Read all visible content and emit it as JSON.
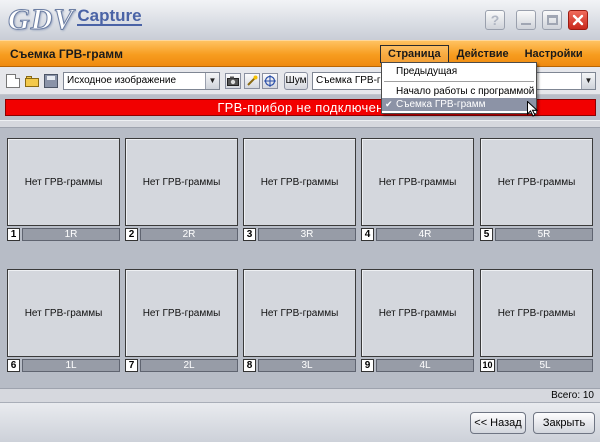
{
  "app": {
    "logo_main": "GDV",
    "logo_sub": "Capture",
    "help_label": "?"
  },
  "header": {
    "title": "Съемка ГРВ-грамм",
    "menu": [
      "Страница",
      "Действие",
      "Настройки"
    ]
  },
  "dropdown": {
    "items": [
      "Предыдущая",
      "Начало работы с программой",
      "Съемка ГРВ-грамм"
    ],
    "checked_index": 2
  },
  "toolbar": {
    "source_select_value": "Исходное изображение",
    "noise_label": "Шум",
    "mode_select_value": "Съемка ГРВ-грамм"
  },
  "status": {
    "message": "ГРВ-прибор не подключен"
  },
  "grid": {
    "cells": [
      {
        "num": "1",
        "label": "1R",
        "placeholder": "Нет ГРВ-граммы"
      },
      {
        "num": "2",
        "label": "2R",
        "placeholder": "Нет ГРВ-граммы"
      },
      {
        "num": "3",
        "label": "3R",
        "placeholder": "Нет ГРВ-граммы"
      },
      {
        "num": "4",
        "label": "4R",
        "placeholder": "Нет ГРВ-граммы"
      },
      {
        "num": "5",
        "label": "5R",
        "placeholder": "Нет ГРВ-граммы"
      },
      {
        "num": "6",
        "label": "1L",
        "placeholder": "Нет ГРВ-граммы"
      },
      {
        "num": "7",
        "label": "2L",
        "placeholder": "Нет ГРВ-граммы"
      },
      {
        "num": "8",
        "label": "3L",
        "placeholder": "Нет ГРВ-граммы"
      },
      {
        "num": "9",
        "label": "4L",
        "placeholder": "Нет ГРВ-граммы"
      },
      {
        "num": "10",
        "label": "5L",
        "placeholder": "Нет ГРВ-граммы"
      }
    ]
  },
  "footer": {
    "total": "Всего: 10",
    "back_label": "<< Назад",
    "close_label": "Закрыть"
  },
  "colors": {
    "header_orange": "#f79c1f",
    "status_red": "#f20000",
    "label_gray": "#979ca7",
    "close_red": "#d9362a"
  }
}
